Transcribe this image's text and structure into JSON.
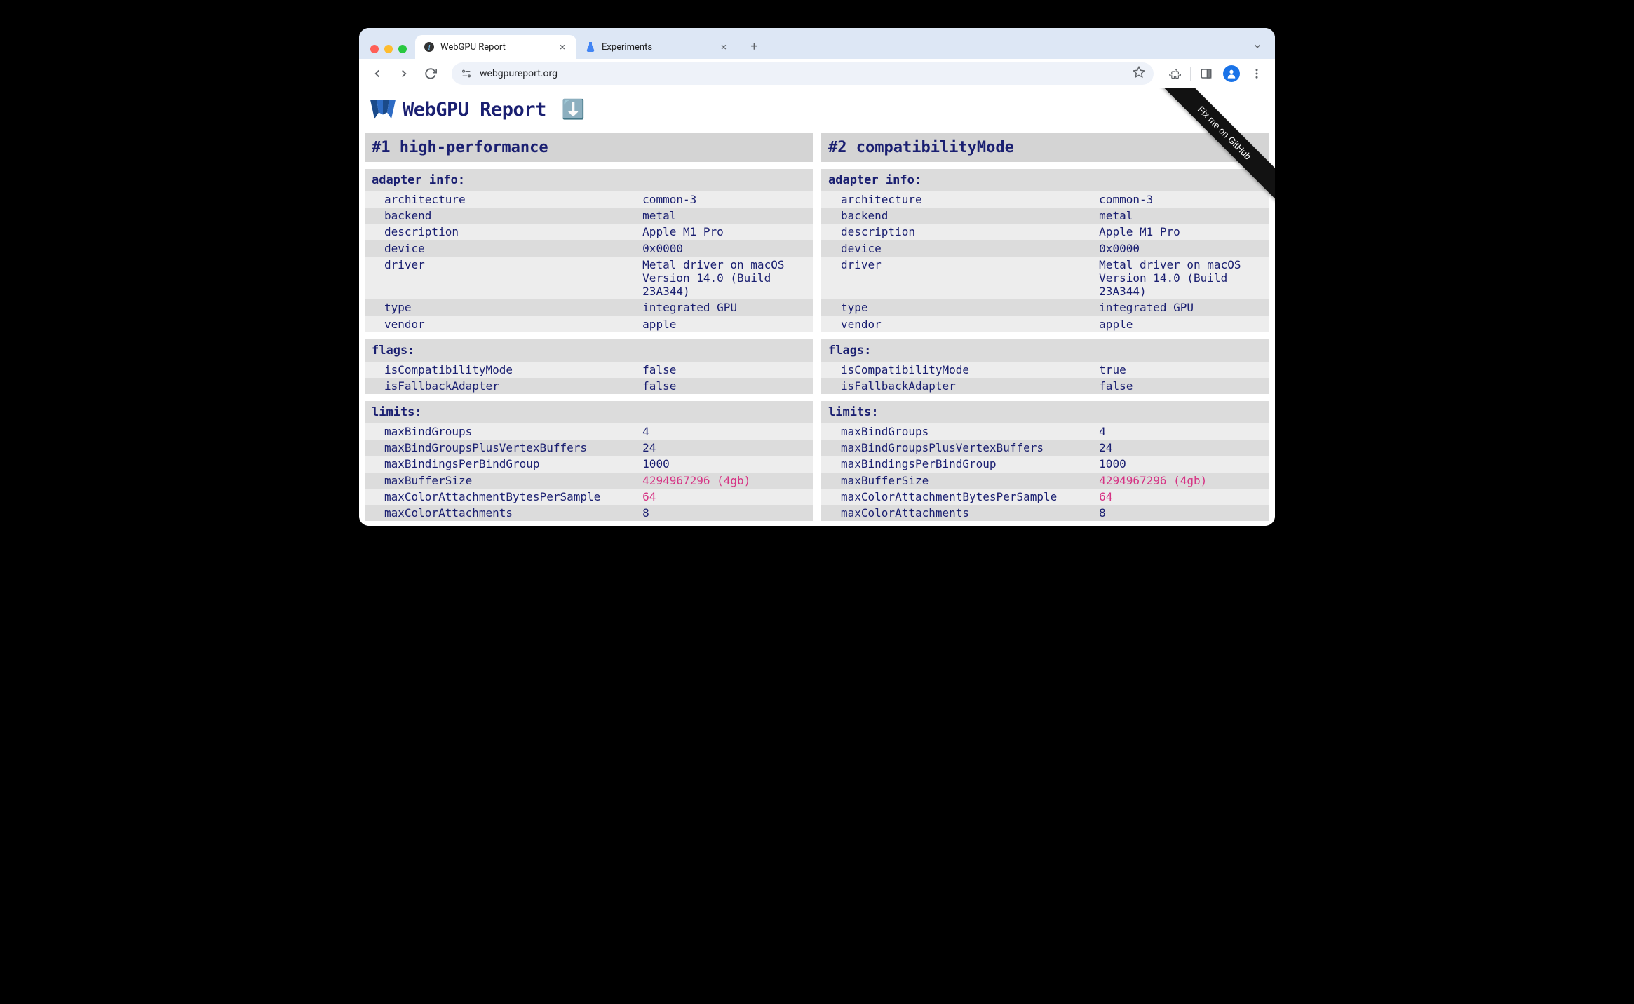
{
  "browser": {
    "tabs": [
      {
        "title": "WebGPU Report",
        "active": true
      },
      {
        "title": "Experiments",
        "active": false
      }
    ],
    "url": "webgpureport.org"
  },
  "page": {
    "title": "WebGPU Report",
    "download_icon": "⬇️",
    "ribbon": "Fix me on GitHub"
  },
  "panels": [
    {
      "heading": "#1 high-performance",
      "sections": [
        {
          "title": "adapter info:",
          "rows": [
            {
              "k": "architecture",
              "v": "common-3"
            },
            {
              "k": "backend",
              "v": "metal"
            },
            {
              "k": "description",
              "v": "Apple M1 Pro"
            },
            {
              "k": "device",
              "v": "0x0000"
            },
            {
              "k": "driver",
              "v": "Metal driver on macOS Version 14.0 (Build 23A344)"
            },
            {
              "k": "type",
              "v": "integrated GPU"
            },
            {
              "k": "vendor",
              "v": "apple"
            }
          ]
        },
        {
          "title": "flags:",
          "rows": [
            {
              "k": "isCompatibilityMode",
              "v": "false"
            },
            {
              "k": "isFallbackAdapter",
              "v": "false"
            }
          ]
        },
        {
          "title": "limits:",
          "rows": [
            {
              "k": "maxBindGroups",
              "v": "4"
            },
            {
              "k": "maxBindGroupsPlusVertexBuffers",
              "v": "24"
            },
            {
              "k": "maxBindingsPerBindGroup",
              "v": "1000"
            },
            {
              "k": "maxBufferSize",
              "v": "4294967296 (4gb)",
              "highlight": true
            },
            {
              "k": "maxColorAttachmentBytesPerSample",
              "v": "64",
              "highlight": true
            },
            {
              "k": "maxColorAttachments",
              "v": "8"
            }
          ]
        }
      ]
    },
    {
      "heading": "#2 compatibilityMode",
      "sections": [
        {
          "title": "adapter info:",
          "rows": [
            {
              "k": "architecture",
              "v": "common-3"
            },
            {
              "k": "backend",
              "v": "metal"
            },
            {
              "k": "description",
              "v": "Apple M1 Pro"
            },
            {
              "k": "device",
              "v": "0x0000"
            },
            {
              "k": "driver",
              "v": "Metal driver on macOS Version 14.0 (Build 23A344)"
            },
            {
              "k": "type",
              "v": "integrated GPU"
            },
            {
              "k": "vendor",
              "v": "apple"
            }
          ]
        },
        {
          "title": "flags:",
          "rows": [
            {
              "k": "isCompatibilityMode",
              "v": "true"
            },
            {
              "k": "isFallbackAdapter",
              "v": "false"
            }
          ]
        },
        {
          "title": "limits:",
          "rows": [
            {
              "k": "maxBindGroups",
              "v": "4"
            },
            {
              "k": "maxBindGroupsPlusVertexBuffers",
              "v": "24"
            },
            {
              "k": "maxBindingsPerBindGroup",
              "v": "1000"
            },
            {
              "k": "maxBufferSize",
              "v": "4294967296 (4gb)",
              "highlight": true
            },
            {
              "k": "maxColorAttachmentBytesPerSample",
              "v": "64",
              "highlight": true
            },
            {
              "k": "maxColorAttachments",
              "v": "8"
            }
          ]
        }
      ]
    }
  ]
}
